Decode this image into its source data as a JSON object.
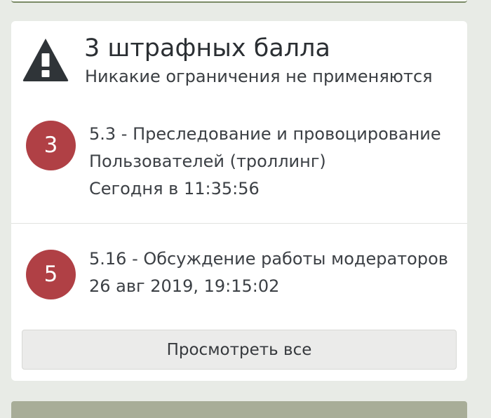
{
  "summary": {
    "title": "3 штрафных балла",
    "subtitle": "Никакие ограничения не применяются",
    "icon": "warning-icon"
  },
  "points": [
    {
      "value": "3",
      "rule_line1": "5.3 - Преследование и провоцирование",
      "rule_line2": "Пользователей (троллинг)",
      "date": "Сегодня в 11:35:56"
    },
    {
      "value": "5",
      "rule_line1": "5.16 - Обсуждение работы модераторов",
      "date": "26 авг 2019, 19:15:02"
    }
  ],
  "actions": {
    "view_all_label": "Просмотреть все"
  },
  "colors": {
    "badge": "#b04045",
    "icon": "#2f3438",
    "button_bg": "#ebebea",
    "page_bg": "#e8ebe6"
  }
}
